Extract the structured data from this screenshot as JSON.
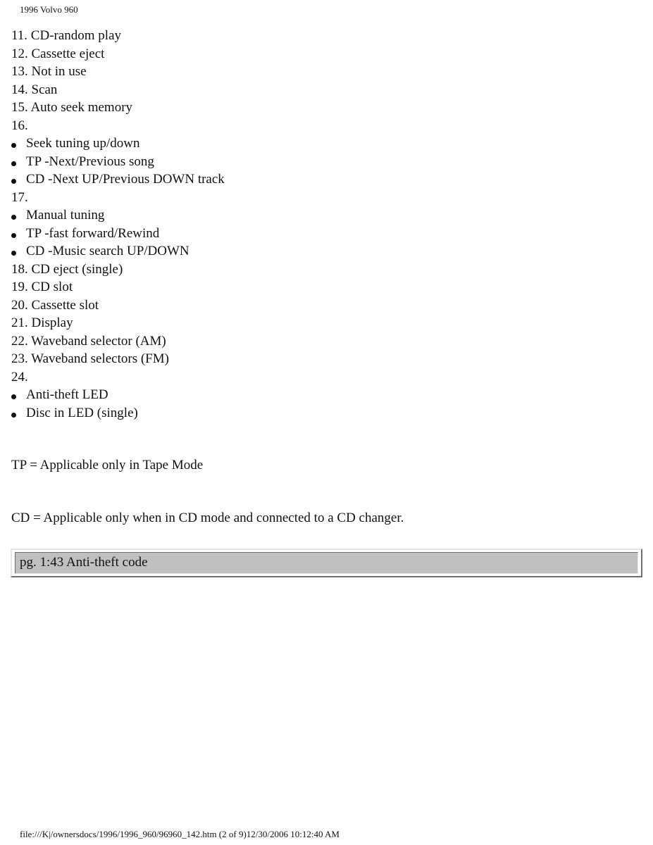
{
  "header": {
    "title": "1996 Volvo 960"
  },
  "items": [
    {
      "type": "line",
      "text": "11. CD-random play"
    },
    {
      "type": "line",
      "text": "12. Cassette eject"
    },
    {
      "type": "line",
      "text": "13. Not in use"
    },
    {
      "type": "line",
      "text": "14. Scan"
    },
    {
      "type": "line",
      "text": "15. Auto seek memory"
    },
    {
      "type": "line",
      "text": "16."
    },
    {
      "type": "bullet",
      "text": "Seek tuning up/down"
    },
    {
      "type": "bullet",
      "text": "TP -Next/Previous song"
    },
    {
      "type": "bullet",
      "text": "CD -Next UP/Previous DOWN track"
    },
    {
      "type": "line",
      "text": "17."
    },
    {
      "type": "bullet",
      "text": "Manual tuning"
    },
    {
      "type": "bullet",
      "text": "TP -fast forward/Rewind"
    },
    {
      "type": "bullet",
      "text": "CD -Music search UP/DOWN"
    },
    {
      "type": "line",
      "text": "18. CD eject (single)"
    },
    {
      "type": "line",
      "text": "19. CD slot"
    },
    {
      "type": "line",
      "text": "20. Cassette slot"
    },
    {
      "type": "line",
      "text": "21. Display"
    },
    {
      "type": "line",
      "text": "22. Waveband selector (AM)"
    },
    {
      "type": "line",
      "text": "23. Waveband selectors (FM)"
    },
    {
      "type": "line",
      "text": "24."
    },
    {
      "type": "bullet",
      "text": "Anti-theft LED"
    },
    {
      "type": "bullet",
      "text": "Disc in LED (single)"
    }
  ],
  "notes": {
    "tp": "TP = Applicable only in Tape Mode",
    "cd": "CD = Applicable only when in CD mode and connected to a CD changer."
  },
  "nav": {
    "link_label": "pg. 1:43 Anti-theft code"
  },
  "footer": {
    "text": "file:///K|/ownersdocs/1996/1996_960/96960_142.htm (2 of 9)12/30/2006 10:12:40 AM"
  }
}
